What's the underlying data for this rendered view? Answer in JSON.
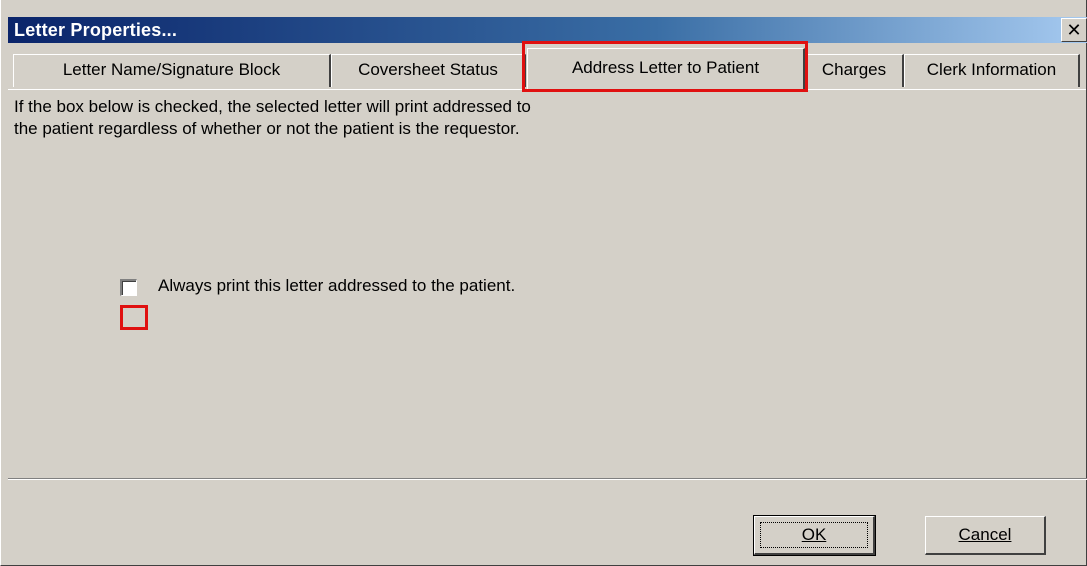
{
  "window": {
    "title": "Letter Properties...",
    "close_glyph": "✕",
    "close_icon": "close-icon"
  },
  "tabs": [
    {
      "label": "Letter Name/Signature  Block",
      "active": false
    },
    {
      "label": "Coversheet Status",
      "active": false
    },
    {
      "label": "Address Letter to Patient",
      "active": true
    },
    {
      "label": "Charges",
      "active": false
    },
    {
      "label": "Clerk Information",
      "active": false
    }
  ],
  "panel": {
    "description_line1": "If the box below is checked, the selected letter will print addressed to",
    "description_line2": "the patient regardless of whether or not the patient is the requestor.",
    "checkbox_label": "Always print this letter addressed to the patient.",
    "checkbox_checked": false
  },
  "buttons": {
    "ok": "OK",
    "cancel": "Cancel"
  },
  "colors": {
    "highlight": "#e01010",
    "face": "#d4d0c8",
    "title_bar": "#0a246a"
  }
}
